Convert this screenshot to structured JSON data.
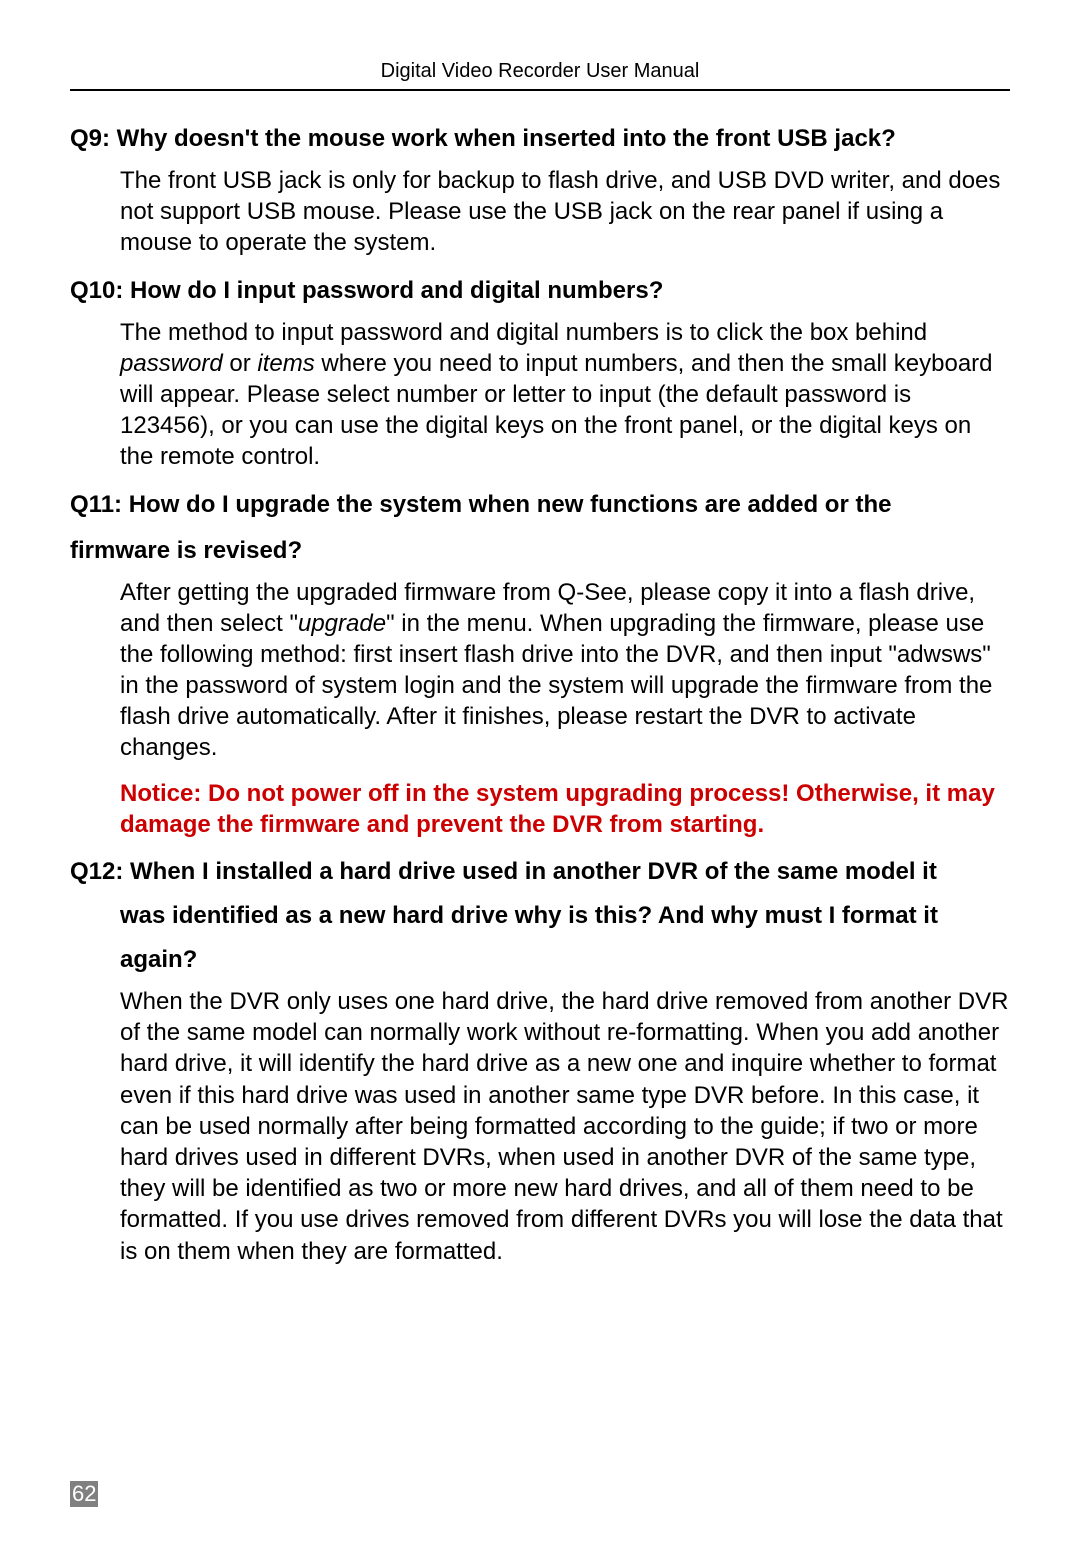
{
  "header": {
    "title": "Digital Video Recorder User Manual"
  },
  "q9": {
    "question": "Q9: Why doesn't the mouse work when inserted into the front USB jack?",
    "answer": "The front USB jack is only for backup to flash drive, and USB DVD writer, and does not support USB mouse. Please use the USB jack on the rear panel if using a mouse to operate the system."
  },
  "q10": {
    "question": "Q10: How do I input password and digital numbers?",
    "answer_pre": "The method to input password and digital numbers is to click the box behind ",
    "italic1": "password",
    "mid": " or ",
    "italic2": "items",
    "answer_post": " where you need to input numbers, and then the small keyboard will appear. Please select number or letter to input (the default password is 123456), or you can use the digital keys on the front panel, or the digital keys on the remote control."
  },
  "q11": {
    "question_line1": "Q11: How do I upgrade the system when new functions are added or the",
    "question_line2": "firmware is revised?",
    "answer_pre": "After getting the upgraded firmware from Q-See, please copy it into a flash drive, and then select \"",
    "italic1": "upgrade",
    "answer_post": "\" in the menu. When upgrading the firmware, please use the following method: first insert flash drive into the DVR, and then input \"adwsws\" in the password of system login and the system will upgrade the firmware from the flash drive automatically. After it finishes, please restart the DVR to activate changes.",
    "notice": "Notice: Do not power off in the system upgrading process! Otherwise, it may damage the firmware and prevent the DVR from starting."
  },
  "q12": {
    "question_line1": "Q12: When I installed a hard drive used in another DVR of the same model it",
    "question_line2": "was identified as a new hard drive why is this? And why must I format it",
    "question_line3": "again?",
    "answer": "When the DVR only uses one hard drive, the hard drive removed from another DVR of the same model can normally work without re-formatting. When you add another hard drive, it will identify the hard drive as a new one and inquire whether to format even if this hard drive was used in another same type DVR before. In this case, it can be used normally after being formatted according to the guide; if two or more hard drives used in different DVRs, when used in another DVR of the same type, they will be identified as two or more new hard drives, and all of them need to be formatted. If you use drives removed from different DVRs you will lose the data that is on them when they are formatted."
  },
  "page_number": "62"
}
